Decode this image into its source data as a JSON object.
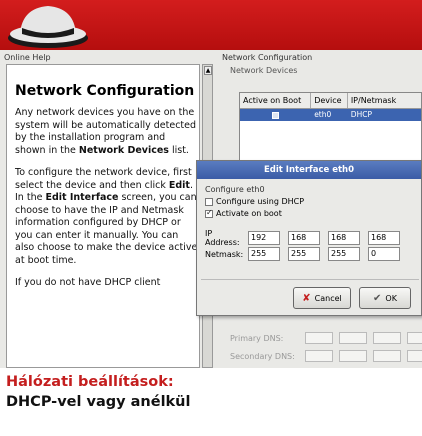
{
  "header": {
    "brand_color": "#c41e1e"
  },
  "help_pane": {
    "label": "Online Help",
    "title": "Network Configuration",
    "p1_a": "Any network devices you have on the system will be automatically detected by the installation program and shown in the ",
    "p1_b": "Network Devices",
    "p1_c": " list.",
    "p2_a": "To configure the network device, first select the device and then click ",
    "p2_b": "Edit",
    "p2_c": ". In the ",
    "p2_d": "Edit Interface",
    "p2_e": " screen, you can choose to have the IP and Netmask information configured by DHCP or you can enter it manually. You can also choose to make the device active at boot time.",
    "p3": "If you do not have DHCP client"
  },
  "main": {
    "label": "Network Configuration",
    "devices_label": "Network Devices",
    "columns": [
      "Active on Boot",
      "Device",
      "IP/Netmask"
    ],
    "row": {
      "device": "eth0",
      "ip": "DHCP"
    },
    "primary_dns": "Primary DNS:",
    "secondary_dns": "Secondary DNS:"
  },
  "dialog": {
    "title": "Edit Interface eth0",
    "section": "Configure eth0",
    "opt_dhcp": "Configure using DHCP",
    "opt_boot": "Activate on boot",
    "ip_label": "IP Address:",
    "netmask_label": "Netmask:",
    "ip": [
      "192",
      "168",
      "168",
      "168"
    ],
    "netmask": [
      "255",
      "255",
      "255",
      "0"
    ],
    "dhcp_checked": false,
    "boot_checked": true,
    "cancel": "Cancel",
    "ok": "OK"
  },
  "caption": {
    "line1": "Hálózati beállítások:",
    "line2": "DHCP-vel vagy anélkül"
  }
}
